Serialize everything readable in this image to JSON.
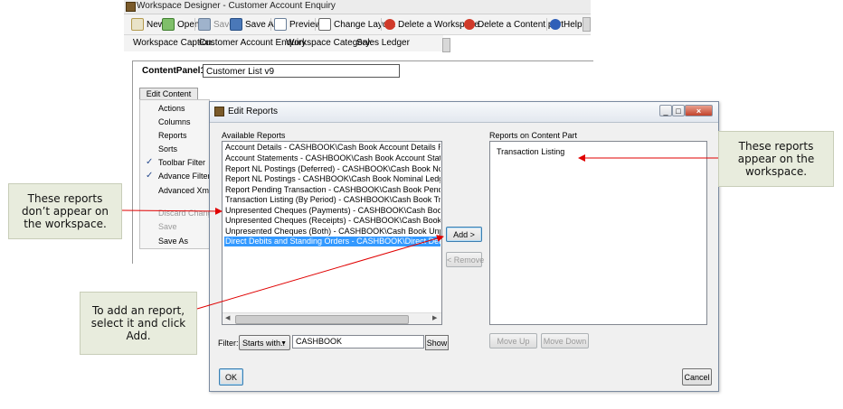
{
  "workspace_designer": {
    "title": "Workspace Designer - Customer Account Enquiry",
    "toolbar": [
      {
        "label": "New",
        "icon": "new-icon"
      },
      {
        "label": "Open",
        "icon": "open-icon"
      },
      {
        "label": "Save",
        "icon": "save-icon",
        "disabled": true
      },
      {
        "label": "Save As",
        "icon": "save-as-icon"
      },
      {
        "label": "Preview",
        "icon": "preview-icon"
      },
      {
        "label": "Change Layout",
        "icon": "layout-icon"
      },
      {
        "label": "Delete a Workspace",
        "icon": "delete-icon"
      },
      {
        "label": "Delete a Content part",
        "icon": "delete-icon"
      },
      {
        "label": "Help",
        "icon": "help-icon"
      }
    ],
    "caption_label": "Workspace Caption:",
    "caption_value": "Customer Account Enquiry",
    "category_label": "Workspace Category:",
    "category_value": "Sales Ledger"
  },
  "content_panel": {
    "label": "ContentPanel1",
    "value": "Customer List v9",
    "edit_button": "Edit Content Part",
    "menu": [
      {
        "label": "Actions"
      },
      {
        "label": "Columns"
      },
      {
        "label": "Reports"
      },
      {
        "label": "Sorts"
      },
      {
        "label": "Toolbar Filter",
        "checked": true
      },
      {
        "label": "Advance Filter",
        "checked": true
      },
      {
        "label": "Advanced Xml C"
      },
      {
        "label": "Discard Change",
        "disabled": true
      },
      {
        "label": "Save",
        "disabled": true
      },
      {
        "label": "Save As"
      }
    ]
  },
  "dialog": {
    "title": "Edit Reports",
    "available_label": "Available Reports",
    "available": [
      "Account Details - CASHBOOK\\Cash Book Account Details Report.rep",
      "Account Statements - CASHBOOK\\Cash Book Account Statement Re",
      "Report NL Postings (Deferred) - CASHBOOK\\Cash Book Nominal Le",
      "Report NL Postings - CASHBOOK\\Cash Book Nominal Ledger Postin",
      "Report Pending Transaction - CASHBOOK\\Cash Book Pending Trans",
      "Transaction Listing (By Period) - CASHBOOK\\Cash Book Transaction",
      "Unpresented Cheques (Payments) - CASHBOOK\\Cash Book Unprese",
      "Unpresented Cheques (Receipts) - CASHBOOK\\Cash Book Unpresen",
      "Unpresented Cheques (Both) - CASHBOOK\\Cash Book Unpresented",
      "Direct Debits and Standing Orders - CASHBOOK\\Direct Debits and S"
    ],
    "selected_index": 9,
    "on_part_label": "Reports on Content Part",
    "on_part": [
      "Transaction Listing"
    ],
    "add": "Add >",
    "remove": "< Remove",
    "move_up": "Move Up",
    "move_down": "Move Down",
    "filter_label": "Filter:",
    "filter_mode": "Starts with..",
    "filter_value": "CASHBOOK",
    "show": "Show",
    "ok": "OK",
    "cancel": "Cancel"
  },
  "callouts": {
    "right": "These reports appear on the workspace.",
    "left": "These reports don’t appear on the workspace.",
    "bottom": "To add an report, select it and click Add."
  }
}
